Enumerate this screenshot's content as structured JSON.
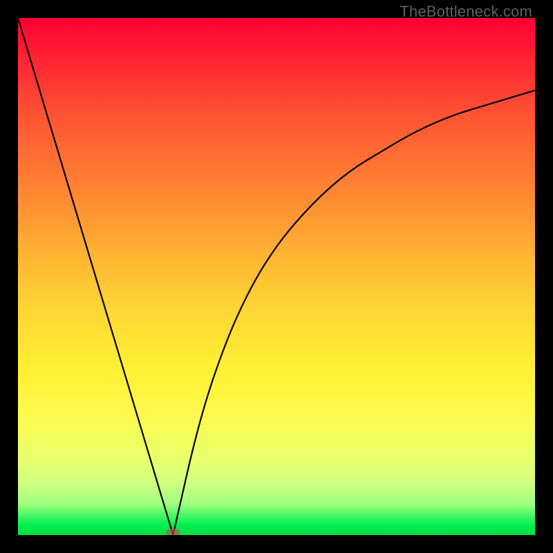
{
  "watermark": "TheBottleneck.com",
  "chart_data": {
    "type": "line",
    "title": "",
    "xlabel": "",
    "ylabel": "",
    "xlim": [
      0,
      100
    ],
    "ylim": [
      0,
      100
    ],
    "x_min_point": 30,
    "left_curve": {
      "x": [
        0,
        30
      ],
      "y": [
        100,
        0
      ]
    },
    "right_curve": {
      "x": [
        30,
        35,
        40,
        45,
        50,
        55,
        60,
        65,
        70,
        75,
        80,
        85,
        90,
        95,
        100
      ],
      "y": [
        0,
        22,
        37,
        48,
        56,
        62,
        67,
        71,
        74,
        77,
        79.5,
        81.5,
        83,
        84.5,
        86
      ]
    },
    "marker": {
      "x": 30,
      "y": 0.5
    },
    "background_gradient": {
      "top": "#ff0033",
      "middle": "#fff033",
      "bottom": "#00e044"
    }
  }
}
